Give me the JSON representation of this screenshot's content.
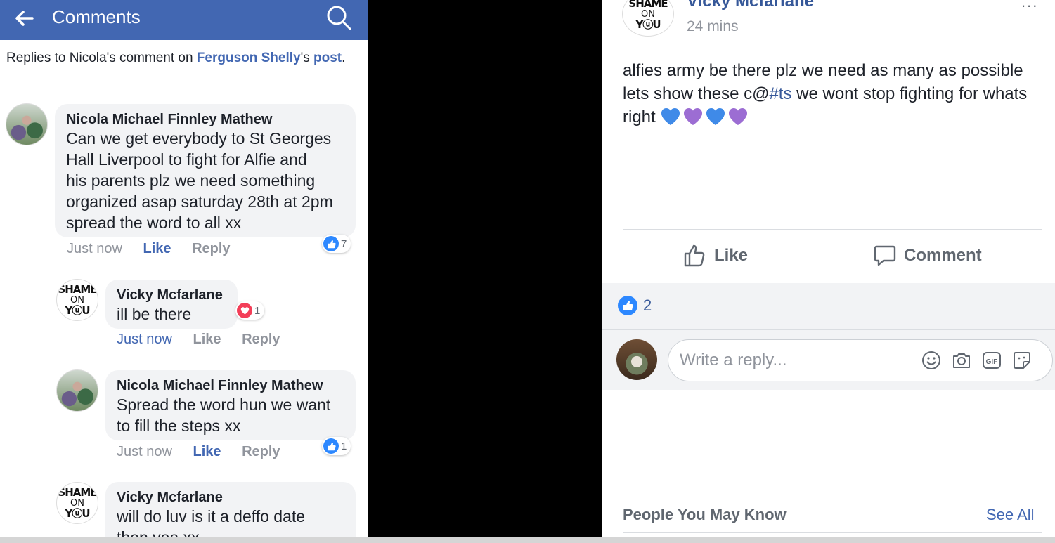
{
  "left": {
    "header": {
      "title": "Comments"
    },
    "context": {
      "prefix": "Replies to Nicola's comment on ",
      "link_user": "Ferguson Shelly",
      "suffix": "'s",
      "link_post": "post",
      "end": "."
    },
    "comments": [
      {
        "author": "Nicola Michael Finnley Mathew",
        "lines": [
          "Can we get everybody to St Georges",
          "Hall Liverpool to fight for Alfie and",
          "his parents plz we need something",
          "organized asap saturday 28th at 2pm",
          "spread the word to all xx"
        ],
        "time": "Just now",
        "like": "Like",
        "reply": "Reply",
        "reaction_count": "7"
      },
      {
        "author": "Vicky Mcfarlane",
        "lines": [
          "ill be there"
        ],
        "time": "Just now",
        "like": "Like",
        "reply": "Reply",
        "reaction_count": "1"
      },
      {
        "author": "Nicola Michael Finnley Mathew",
        "lines": [
          "Spread the word hun we want",
          "to fill the steps xx"
        ],
        "time": "Just now",
        "like": "Like",
        "reply": "Reply",
        "reaction_count": "1"
      },
      {
        "author": "Vicky Mcfarlane",
        "lines": [
          "will do luv is it a deffo date",
          "then yea xx"
        ]
      }
    ],
    "avatar_text": {
      "line1": "SHAME",
      "line2": "ON",
      "line3": "YⓤU"
    }
  },
  "right": {
    "post": {
      "author": "Vicky Mcfarlane",
      "time": "24 mins",
      "more": "...",
      "text_a": "alfies army be there plz we need as many as possible lets show these c@",
      "hashtag": "#ts",
      "text_b": " we wont stop fighting for whats right "
    },
    "actions": {
      "like": "Like",
      "comment": "Comment"
    },
    "likes_count": "2",
    "reply_placeholder": "Write a reply...",
    "reply_tools": [
      "smiley-icon",
      "camera-icon",
      "gif-icon",
      "sticker-icon"
    ],
    "gif_label": "GIF",
    "pymk": {
      "title": "People You May Know",
      "see_all": "See All"
    }
  },
  "colors": {
    "header_blue": "#4267b2",
    "link_blue": "#365899",
    "like_blue": "#2d88ff",
    "love_red": "#f33e58",
    "blue_heart": "#3f8ae8",
    "purple_heart": "#9c6dd3"
  }
}
